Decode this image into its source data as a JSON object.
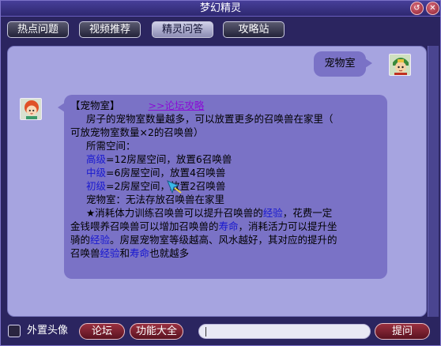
{
  "window": {
    "title": "梦幻精灵",
    "restore_icon": "restore-icon",
    "close_icon": "close-icon"
  },
  "tabs": [
    {
      "label": "热点问题",
      "active": false
    },
    {
      "label": "视频推荐",
      "active": false
    },
    {
      "label": "精灵问答",
      "active": true
    },
    {
      "label": "攻略站",
      "active": false
    }
  ],
  "chat": {
    "user_message": "宠物室",
    "answer": {
      "heading": "【宠物室】",
      "link": ">>论坛攻略",
      "para1_line1": "房子的宠物室数量越多，可以放置更多的召唤兽在家里（",
      "para1_line2": "可放宠物室数量×2的召唤兽）",
      "space_label": "所需空间：",
      "levels": [
        {
          "name": "高级",
          "rest": "=12房屋空间，放置6召唤兽"
        },
        {
          "name": "中级",
          "rest": "=6房屋空间，放置4召唤兽"
        },
        {
          "name": "初级",
          "rest": "=2房屋空间，放置2召唤兽"
        }
      ],
      "no_room": "宠物室：无法存放召唤兽在家里",
      "tip": {
        "l1_a": "★消耗体力训练召唤兽可以提升召唤兽的",
        "l1_kw": "经验",
        "l1_b": "，花费一定",
        "l2_a": "金钱喂养召唤兽可以增加召唤兽的",
        "l2_kw": "寿命",
        "l2_b": "，消耗活力可以提升坐",
        "l3_a": "骑的",
        "l3_kw": "经验",
        "l3_b": "。房屋宠物室等级越高、风水越好，其对应的提升的",
        "l4_a": "召唤兽",
        "l4_kw1": "经验",
        "l4_mid": "和",
        "l4_kw2": "寿命",
        "l4_b": "也就越多"
      }
    },
    "colors": {
      "keyword": "#1818d0",
      "link": "#8a0cd6",
      "bubble": "#7a72c6",
      "panel": "#a6a4e0"
    }
  },
  "bottom": {
    "checkbox_label": "外置头像",
    "forum_button": "论坛",
    "features_button": "功能大全",
    "question_input_value": "",
    "ask_button": "提问"
  }
}
